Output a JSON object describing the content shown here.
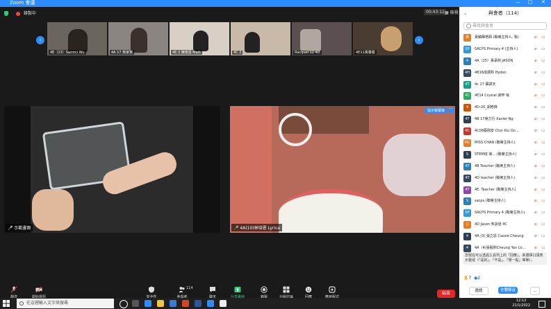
{
  "window": {
    "title": "Zoom 會議",
    "controls": [
      "—",
      "□",
      "✕"
    ]
  },
  "meeting_top": {
    "recording": "錄製中",
    "timer": "00:43:12",
    "view_label": "檢視"
  },
  "thumbnails": [
    {
      "name": "4E（23）Sammi Wu"
    },
    {
      "name": "4A 17 吳家賢"
    },
    {
      "name": "4E 3 陳皓恩 Matt"
    },
    {
      "name": "4C 2"
    },
    {
      "name": "Racquel 12 4D"
    },
    {
      "name": "4E11黃譽駿"
    }
  ],
  "nav": {
    "prev": "‹",
    "next": "›"
  },
  "tiles": {
    "left": {
      "name": "示範畫面"
    },
    "right": {
      "name": "4A(10)林培恩 Lyrica",
      "tag": "提示螢幕錄",
      "more": "···"
    }
  },
  "toolbar": {
    "mute": "靜音",
    "video": "開始視訊",
    "security": "安全性",
    "participants": "參與者",
    "participants_count": "114",
    "chat": "聊天",
    "share": "分享畫面",
    "record": "錄製",
    "breakout": "分組討論",
    "reactions": "回應",
    "apps": "應用程式",
    "end": "結束"
  },
  "panel": {
    "title": "與會者（114）",
    "search_placeholder": "尋找與會者",
    "participants": [
      {
        "initial": "黃",
        "color": "#e67e22",
        "name": "黃鎮輝老師 (聯席主持人, 我)"
      },
      {
        "initial": "SP",
        "color": "#3498db",
        "name": "SACPS Primary 4 (主持人)"
      },
      {
        "initial": "4",
        "color": "#2980b9",
        "name": "4A（25）黃承熙 JASON"
      },
      {
        "initial": "4H",
        "color": "#34495e",
        "name": "4B16成譔熙 Hyden"
      },
      {
        "initial": "4T",
        "color": "#16a085",
        "name": "4c 17 蘇譯天"
      },
      {
        "initial": "4C",
        "color": "#27ae60",
        "name": "4E14 Crystal 謝梓 瑤"
      },
      {
        "initial": "4",
        "color": "#d35400",
        "name": "4D-20_胡皓鋒"
      },
      {
        "initial": "4T",
        "color": "#2c3e50",
        "name": "4B 17吳力行 Xavier Ng"
      },
      {
        "initial": "4C",
        "color": "#c0392b",
        "name": "4C08蔡翹安 Choi Kiu On..."
      },
      {
        "initial": "MC",
        "color": "#e67e22",
        "name": "MISS CHAN (聯席主持人)"
      },
      {
        "initial": "S",
        "color": "#2c3e50",
        "name": "STEM班 導... (聯席主持人)"
      },
      {
        "initial": "4T",
        "color": "#2980b9",
        "name": "4B Teacher (聯席主持人)"
      },
      {
        "initial": "4T",
        "color": "#34495e",
        "name": "4D teacher (聯席主持人)"
      },
      {
        "initial": "4T",
        "color": "#8e44ad",
        "name": "4E. Teacher (聯席主持人)"
      },
      {
        "initial": "S",
        "color": "#2980b9",
        "name": "sacps (聯席主持人)"
      },
      {
        "initial": "SP",
        "color": "#3498db",
        "name": "SACPS Primary 4 (聯席主持人)"
      },
      {
        "initial": "IJ",
        "color": "#e67e22",
        "name": "4D Jason 朱詠發 4C"
      },
      {
        "initial": "4",
        "color": "#2c3e50",
        "name": "4A (3) 張立恩 Cassie Cheung"
      },
      {
        "initial": "4",
        "color": "#34495e",
        "name": "4A（4)張殷熙Cheung Yan Lo..."
      }
    ],
    "note": "您現在可以透過工具列上的「回應」，來選擇口頭表示贊成（「是的」、「不是」、「慢一點」等等）。",
    "reaction_counts": {
      "raise_hand": "7",
      "thumbs": "2"
    },
    "invite": "邀請",
    "mute_all": "全體靜音",
    "more": "..."
  },
  "taskbar": {
    "search_placeholder": "在這裡輸入文字來搜尋",
    "time": "12:12",
    "date": "21/1/2022"
  }
}
